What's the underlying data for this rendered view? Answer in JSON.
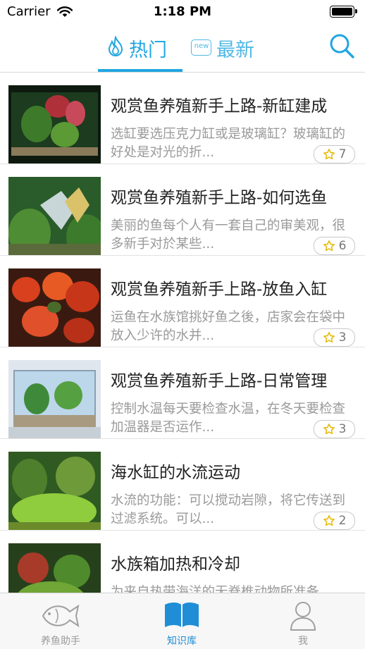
{
  "status_bar": {
    "carrier": "Carrier",
    "time": "1:18 PM"
  },
  "nav": {
    "tabs": [
      {
        "label": "热门",
        "icon": "flame-icon",
        "active": true
      },
      {
        "label": "最新",
        "icon": "new-badge-icon",
        "badge_text": "new",
        "active": false
      }
    ],
    "search_icon": "search-icon",
    "accent_color": "#21a6e0"
  },
  "articles": [
    {
      "title": "观赏鱼养殖新手上路-新缸建成",
      "desc": "选缸要选压克力缸或是玻璃缸？玻璃缸的好处是对光的折...",
      "stars": "7"
    },
    {
      "title": "观赏鱼养殖新手上路-如何选鱼",
      "desc": "美丽的鱼每个人有一套自己的审美观，很多新手对於某些...",
      "stars": "6"
    },
    {
      "title": "观赏鱼养殖新手上路-放鱼入缸",
      "desc": "运鱼在水族馆挑好鱼之後，店家会在袋中放入少许的水并...",
      "stars": "3"
    },
    {
      "title": "观赏鱼养殖新手上路-日常管理",
      "desc": "控制水温每天要检查水温，在冬天要检查加温器是否运作...",
      "stars": "3"
    },
    {
      "title": "海水缸的水流运动",
      "desc": "水流的功能：可以搅动岩隙，将它传送到过滤系统。可以...",
      "stars": "2"
    },
    {
      "title": "水族箱加热和冷却",
      "desc": "为来自热带海洋的无脊椎动物所准备",
      "stars": ""
    }
  ],
  "tabbar": {
    "items": [
      {
        "label": "养鱼助手",
        "icon": "fish-icon",
        "active": false
      },
      {
        "label": "知识库",
        "icon": "book-icon",
        "active": true
      },
      {
        "label": "我",
        "icon": "person-icon",
        "active": false
      }
    ]
  }
}
